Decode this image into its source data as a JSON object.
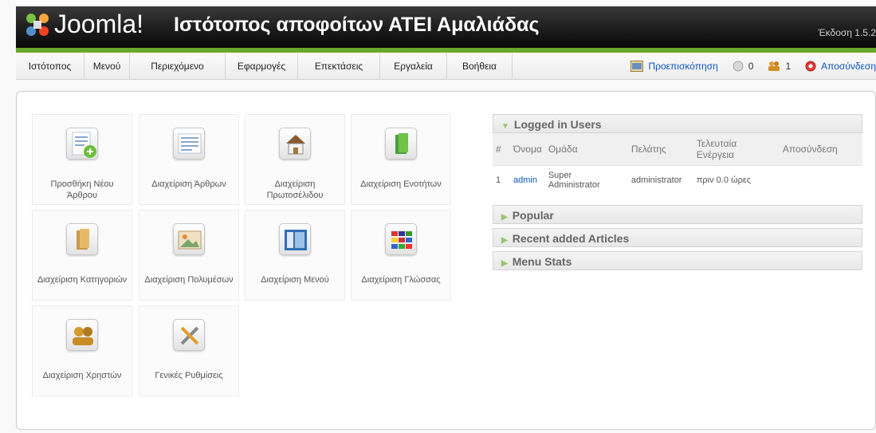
{
  "header": {
    "logo_text": "Joomla!",
    "site_title": "Ιστότοπος αποφοίτων ΑΤΕΙ Αμαλιάδας",
    "version": "Έκδοση 1.5.2"
  },
  "menu": {
    "items": [
      "Ιστότοπος",
      "Μενού",
      "Περιεχόμενο",
      "Εφαρμογές",
      "Επεκτάσεις",
      "Εργαλεία",
      "Βοήθεια"
    ],
    "preview": "Προεπισκόπηση",
    "messages_count": "0",
    "users_count": "1",
    "logout": "Αποσύνδεση"
  },
  "icons": [
    {
      "label": "Προσθήκη Νέου Άρθρου",
      "icon": "add-article-icon"
    },
    {
      "label": "Διαχείριση Άρθρων",
      "icon": "articles-icon"
    },
    {
      "label": "Διαχείριση Πρωτοσέλιδου",
      "icon": "frontpage-icon"
    },
    {
      "label": "Διαχείριση Ενοτήτων",
      "icon": "sections-icon"
    },
    {
      "label": "Διαχείριση Κατηγοριών",
      "icon": "categories-icon"
    },
    {
      "label": "Διαχείριση Πολυμέσων",
      "icon": "media-icon"
    },
    {
      "label": "Διαχείριση Μενού",
      "icon": "menu-icon"
    },
    {
      "label": "Διαχείριση Γλώσσας",
      "icon": "language-icon"
    },
    {
      "label": "Διαχείριση Χρηστών",
      "icon": "users-icon"
    },
    {
      "label": "Γενικές Ρυθμίσεις",
      "icon": "config-icon"
    }
  ],
  "logged_in": {
    "title": "Logged in Users",
    "columns": [
      "#",
      "Όνομα",
      "Ομάδα",
      "Πελάτης",
      "Τελευταία Ενέργεια",
      "Αποσύνδεση"
    ],
    "rows": [
      {
        "num": "1",
        "name": "admin",
        "group": "Super Administrator",
        "client": "administrator",
        "last": "πριν 0.0 ώρες"
      }
    ]
  },
  "panes": [
    "Popular",
    "Recent added Articles",
    "Menu Stats"
  ],
  "colors": {
    "accent_green": "#69a82a",
    "link_blue": "#0b55c4"
  }
}
